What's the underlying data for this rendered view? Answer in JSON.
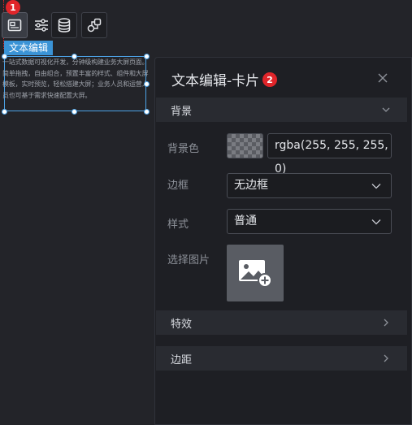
{
  "toolbar": {
    "badge": "1",
    "buttons": [
      {
        "icon": "image-card-icon"
      },
      {
        "icon": "sliders-icon"
      },
      {
        "icon": "database-icon"
      },
      {
        "icon": "link-shapes-icon"
      }
    ]
  },
  "component": {
    "tag": "文本编辑",
    "text": "一站式数据可视化开发，分钟级构建业务大屏页面。简单拖拽，自由组合，预置丰富的样式、组件和大屏模板，实时预览，轻松搭建大屏；业务人员和运营人员也可基于需求快速配置大屏。"
  },
  "panel": {
    "title": "文本编辑-卡片",
    "badge": "2",
    "sections": {
      "background": "背景",
      "effects": "特效",
      "margin": "边距"
    },
    "fields": {
      "bg_color_label": "背景色",
      "bg_color_value": "rgba(255, 255, 255, 0)",
      "border_label": "边框",
      "border_value": "无边框",
      "style_label": "样式",
      "style_value": "普通",
      "image_label": "选择图片"
    }
  },
  "colors": {
    "accent": "#3a93d6",
    "badge": "#e0252a",
    "panel_bg": "#1e1f24",
    "page_bg": "#232429"
  }
}
